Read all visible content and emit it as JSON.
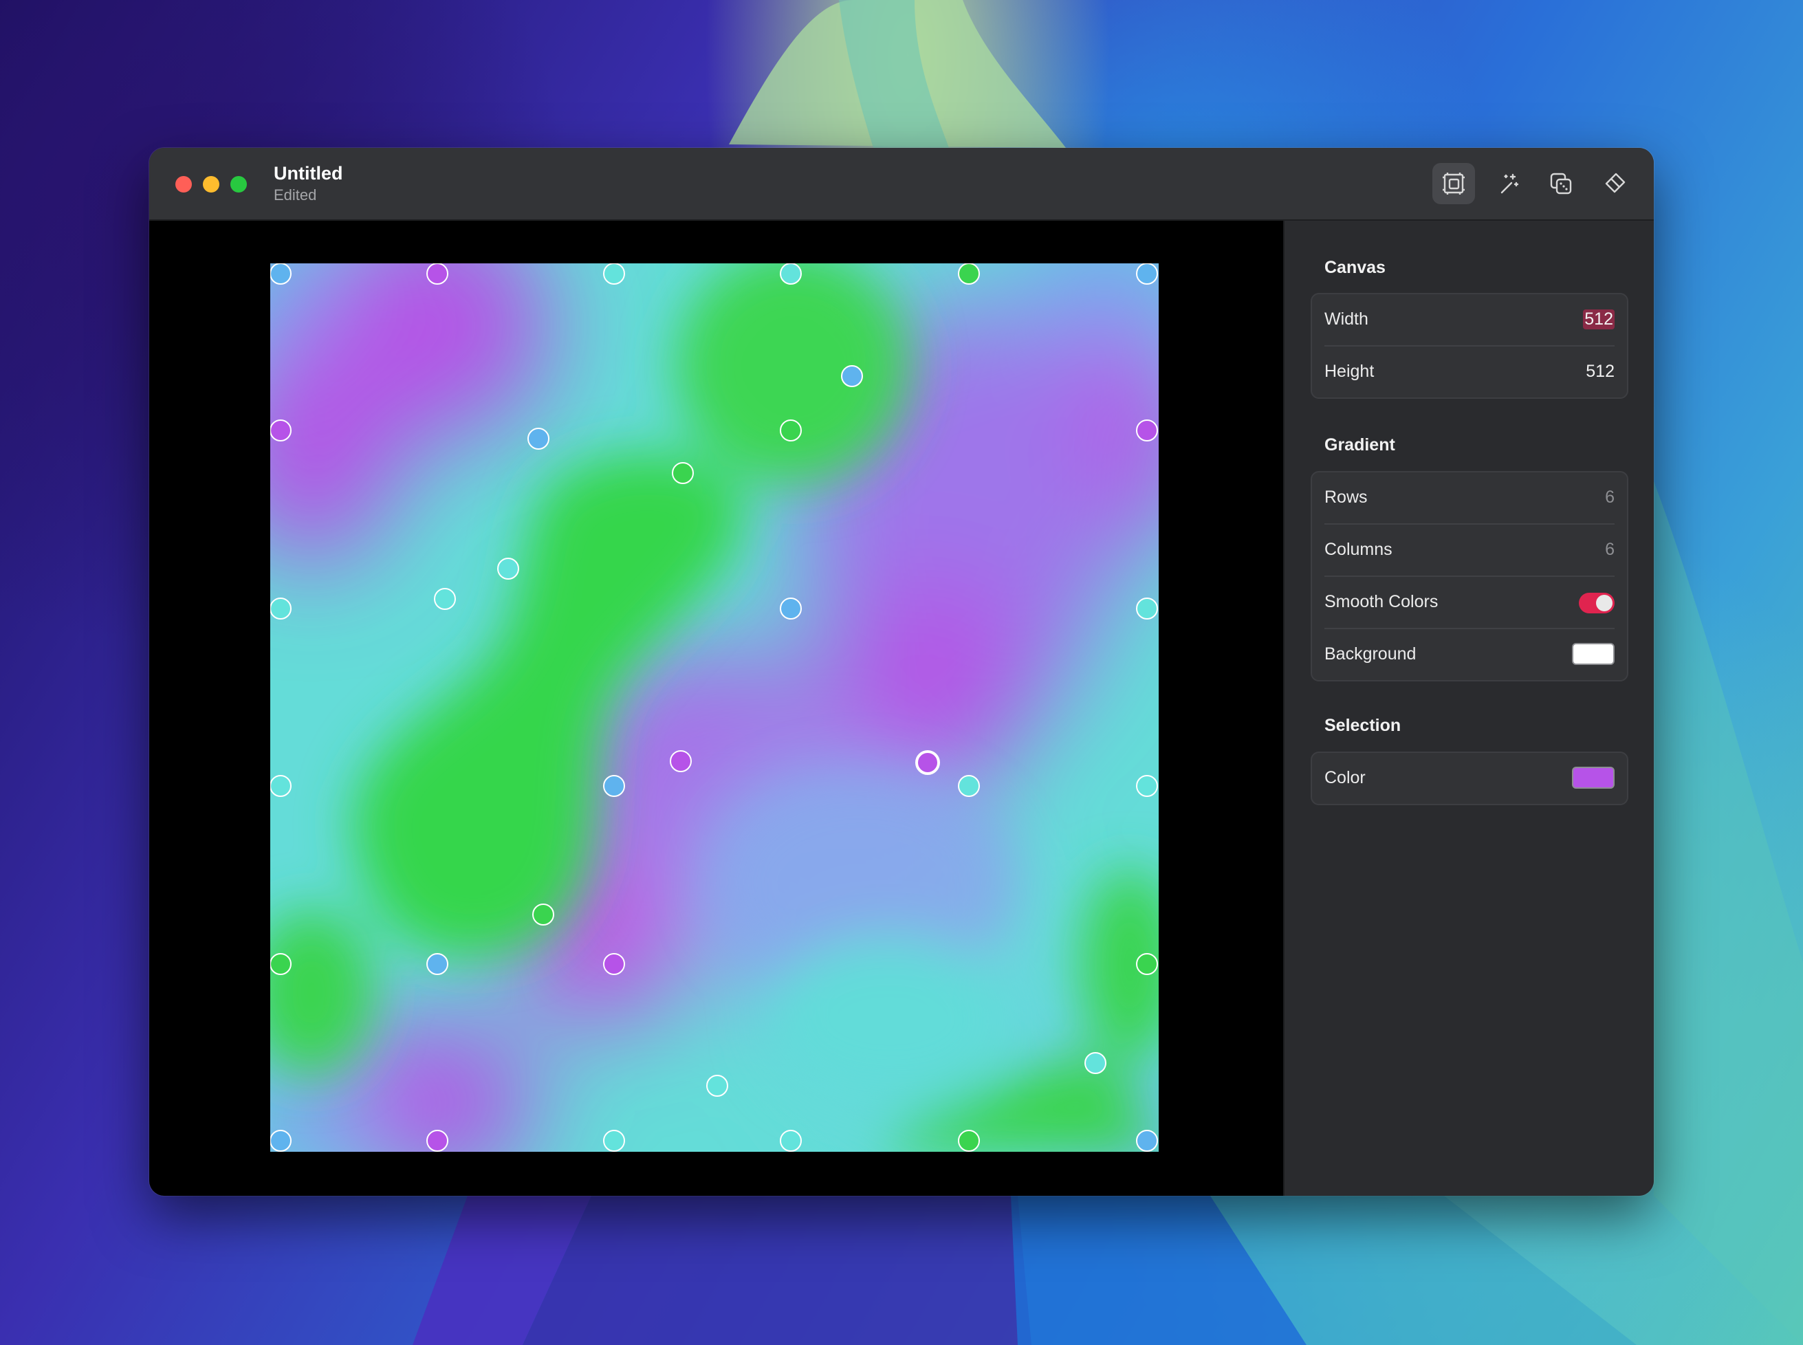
{
  "window": {
    "title": "Untitled",
    "subtitle": "Edited"
  },
  "toolbar": {
    "buttons": [
      {
        "icon": "canvas-frame-icon",
        "active": true
      },
      {
        "icon": "magic-wand-icon",
        "active": false
      },
      {
        "icon": "dice-randomize-icon",
        "active": false
      },
      {
        "icon": "eraser-icon",
        "active": false
      }
    ]
  },
  "inspector": {
    "canvas": {
      "title": "Canvas",
      "width_label": "Width",
      "width_value": "512",
      "height_label": "Height",
      "height_value": "512"
    },
    "gradient": {
      "title": "Gradient",
      "rows_label": "Rows",
      "rows_value": "6",
      "columns_label": "Columns",
      "columns_value": "6",
      "smooth_label": "Smooth Colors",
      "smooth_on": true,
      "background_label": "Background",
      "background_color": "#ffffff"
    },
    "selection": {
      "title": "Selection",
      "color_label": "Color",
      "color_value": "#b653e8"
    }
  },
  "colors": {
    "accent": "#e0244f",
    "purple": "#b653e8",
    "cyan": "#63e3dc",
    "blue": "#5fb3ee",
    "green": "#3ad44f"
  }
}
